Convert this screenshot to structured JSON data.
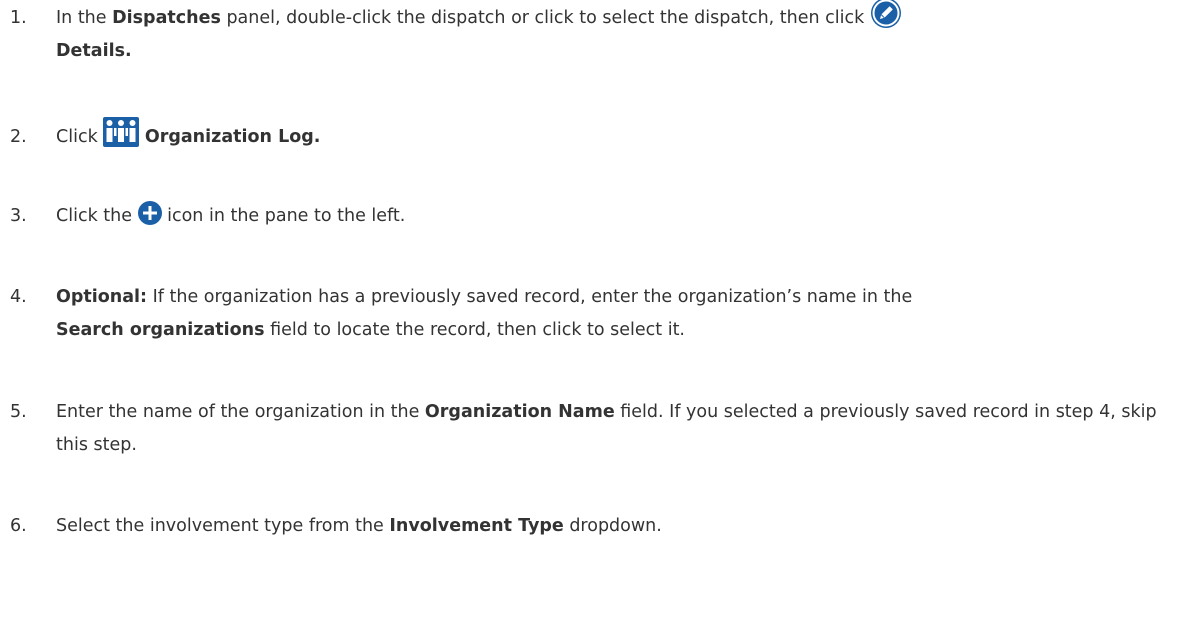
{
  "steps": [
    {
      "number": "1.",
      "text_a": "In the ",
      "bold_a": "Dispatches",
      "text_b": " panel, double-click the dispatch or click to select the dispatch, then click ",
      "icon": "pencil-edit-icon",
      "bold_b": "Details."
    },
    {
      "number": "2.",
      "text_a": "Click ",
      "icon": "organization-log-icon",
      "bold_a": "Organization Log."
    },
    {
      "number": "3.",
      "text_a": "Click the ",
      "icon": "add-circle-icon",
      "text_b": " icon in the pane to the left."
    },
    {
      "number": "4.",
      "bold_a": "Optional:",
      "text_a": " If the organization has a previously saved record, enter the organization’s name in the ",
      "bold_b": "Search organizations",
      "text_b": " field to locate the record, then click to select it."
    },
    {
      "number": "5.",
      "text_a": "Enter the name of the organization in the ",
      "bold_a": "Organization Name",
      "text_b": " field. If you selected a previously saved record in step 4, skip this step."
    },
    {
      "number": "6.",
      "text_a": "Select the involvement type from the ",
      "bold_a": "Involvement Type",
      "text_b": " dropdown."
    }
  ],
  "colors": {
    "text": "#333333",
    "icon_blue": "#1b5fa6"
  }
}
